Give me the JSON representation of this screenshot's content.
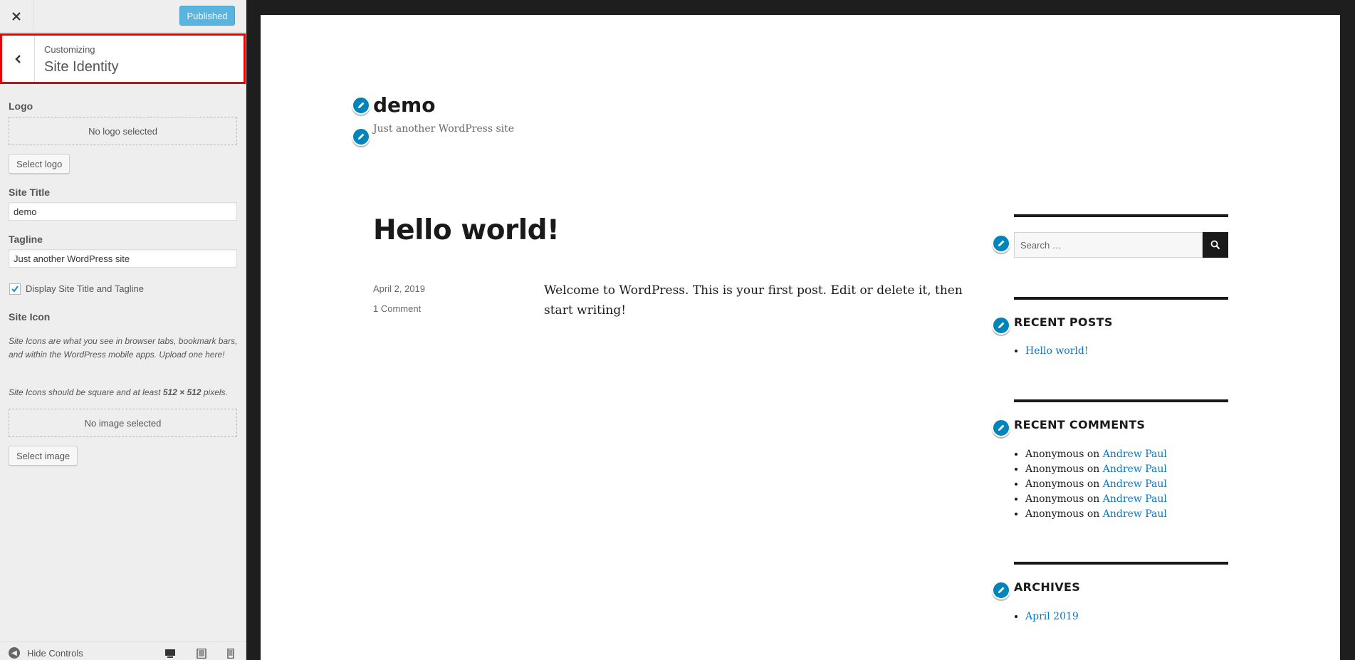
{
  "sidebar": {
    "published_label": "Published",
    "customizing_label": "Customizing",
    "section_title": "Site Identity",
    "logo": {
      "label": "Logo",
      "placeholder": "No logo selected",
      "button": "Select logo"
    },
    "site_title": {
      "label": "Site Title",
      "value": "demo"
    },
    "tagline": {
      "label": "Tagline",
      "value": "Just another WordPress site"
    },
    "display_title_checkbox": {
      "label": "Display Site Title and Tagline",
      "checked": true
    },
    "site_icon": {
      "label": "Site Icon",
      "desc1": "Site Icons are what you see in browser tabs, bookmark bars, and within the WordPress mobile apps. Upload one here!",
      "desc2_pre": "Site Icons should be square and at least ",
      "desc2_bold": "512 × 512",
      "desc2_post": " pixels.",
      "placeholder": "No image selected",
      "button": "Select image"
    },
    "footer": {
      "hide_controls": "Hide Controls"
    },
    "accent_color": "#0085ba",
    "highlight_border_color": "#ee0000"
  },
  "preview": {
    "site_title": "demo",
    "site_tagline": "Just another WordPress site",
    "post": {
      "title": "Hello world!",
      "date": "April 2, 2019",
      "comments": "1 Comment",
      "content": "Welcome to WordPress. This is your first post. Edit or delete it, then start writing!"
    },
    "search": {
      "placeholder": "Search …"
    },
    "recent_posts": {
      "title": "RECENT POSTS",
      "items": [
        "Hello world!"
      ]
    },
    "recent_comments": {
      "title": "RECENT COMMENTS",
      "items": [
        {
          "author": "Anonymous",
          "on": "on",
          "post": "Andrew Paul"
        },
        {
          "author": "Anonymous",
          "on": "on",
          "post": "Andrew Paul"
        },
        {
          "author": "Anonymous",
          "on": "on",
          "post": "Andrew Paul"
        },
        {
          "author": "Anonymous",
          "on": "on",
          "post": "Andrew Paul"
        },
        {
          "author": "Anonymous",
          "on": "on",
          "post": "Andrew Paul"
        }
      ]
    },
    "archives": {
      "title": "ARCHIVES",
      "items": [
        "April 2019"
      ]
    },
    "link_color": "#007acc"
  }
}
